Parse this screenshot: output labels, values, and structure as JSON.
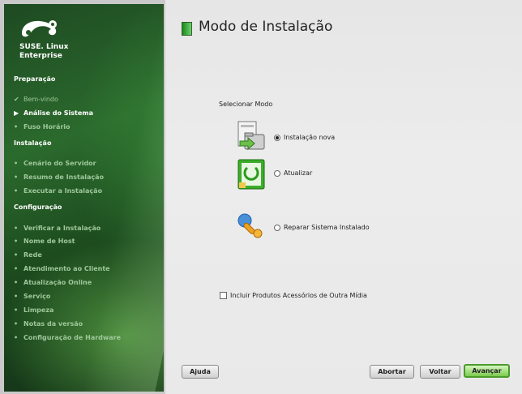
{
  "sidebar": {
    "brand_line1": "SUSE. Linux",
    "brand_line2": "Enterprise",
    "sections": [
      {
        "title": "Preparação",
        "items": [
          {
            "label": "Bem-vindo",
            "state": "done"
          },
          {
            "label": "Análise do Sistema",
            "state": "current"
          },
          {
            "label": "Fuso Horário",
            "state": "pending"
          }
        ]
      },
      {
        "title": "Instalação",
        "items": [
          {
            "label": "Cenário do Servidor",
            "state": "pending"
          },
          {
            "label": "Resumo de Instalação",
            "state": "pending"
          },
          {
            "label": "Executar a Instalação",
            "state": "pending"
          }
        ]
      },
      {
        "title": "Configuração",
        "items": [
          {
            "label": "Verificar a Instalação",
            "state": "pending"
          },
          {
            "label": "Nome de Host",
            "state": "pending"
          },
          {
            "label": "Rede",
            "state": "pending"
          },
          {
            "label": "Atendimento ao Cliente",
            "state": "pending"
          },
          {
            "label": "Atualização Online",
            "state": "pending"
          },
          {
            "label": "Serviço",
            "state": "pending"
          },
          {
            "label": "Limpeza",
            "state": "pending"
          },
          {
            "label": "Notas da versão",
            "state": "pending"
          },
          {
            "label": "Configuração de Hardware",
            "state": "pending"
          }
        ]
      }
    ]
  },
  "main": {
    "title": "Modo de Instalação",
    "select_mode_label": "Selecionar Modo",
    "options": {
      "new_install": {
        "label": "Instalação nova",
        "selected": true
      },
      "update": {
        "label": "Atualizar",
        "selected": false
      },
      "repair": {
        "label": "Reparar Sistema Instalado",
        "selected": false
      }
    },
    "include_addon": {
      "label": "Incluir Produtos Acessórios de Outra Mídia",
      "checked": false
    }
  },
  "buttons": {
    "help": "Ajuda",
    "abort": "Abortar",
    "back": "Voltar",
    "next": "Avançar"
  },
  "icons": {
    "new_install": "folder-install-icon",
    "update": "update-icon",
    "repair": "repair-wrench-icon"
  },
  "colors": {
    "sidebar_green": "#2b6a2d",
    "accent_green": "#4a9b2a"
  }
}
